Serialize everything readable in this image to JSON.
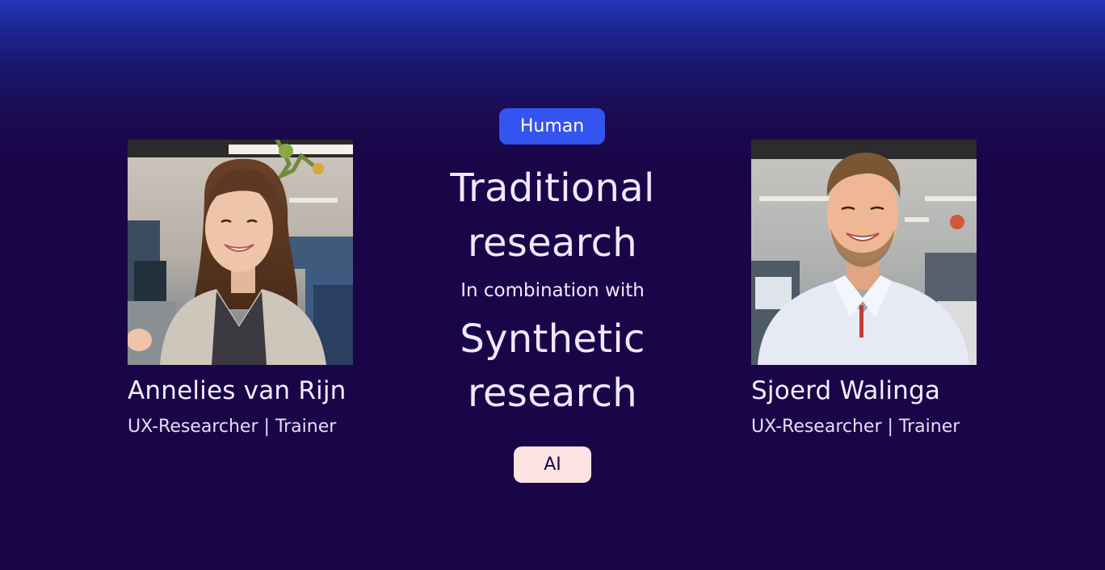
{
  "badges": {
    "top": "Human",
    "bottom": "AI"
  },
  "headline": {
    "line1": "Traditional",
    "line2": "research",
    "connector": "In combination with",
    "line3": "Synthetic",
    "line4": "research"
  },
  "speakers": [
    {
      "name": "Annelies van Rijn",
      "role": "UX-Researcher | Trainer"
    },
    {
      "name": "Sjoerd Walinga",
      "role": "UX-Researcher | Trainer"
    }
  ],
  "colors": {
    "background": "#1b0549",
    "human_badge": "#3454f0",
    "ai_badge": "#fde3e2",
    "text": "#efe9ff"
  }
}
